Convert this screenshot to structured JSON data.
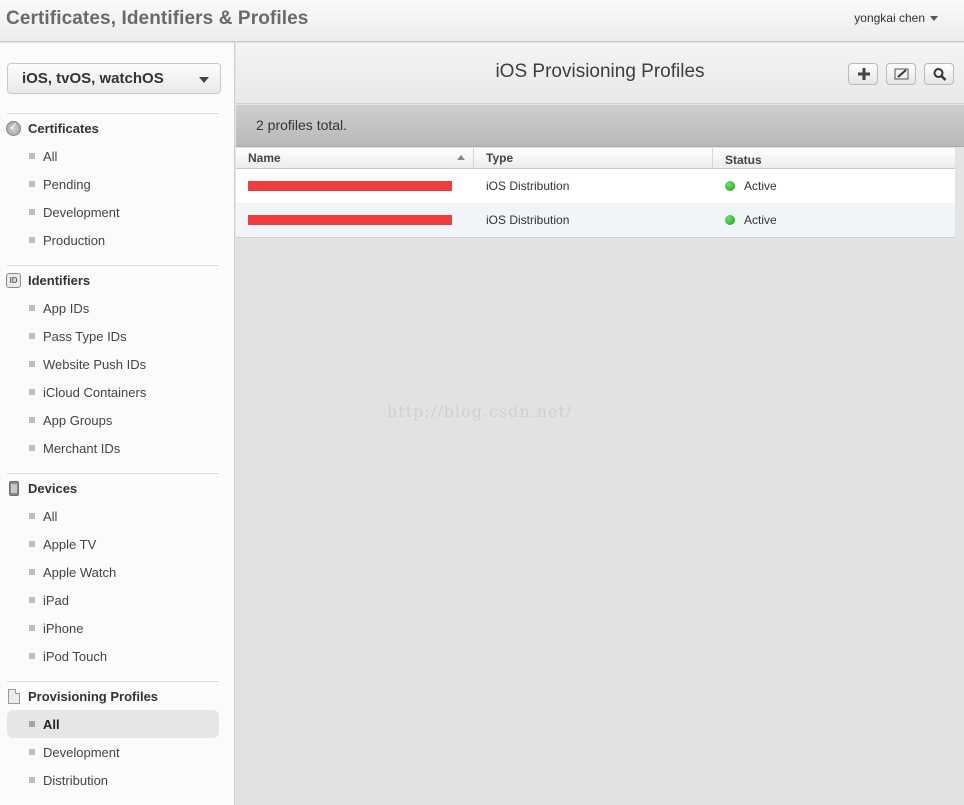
{
  "header": {
    "title": "Certificates, Identifiers & Profiles",
    "user": "yongkai chen"
  },
  "sidebar": {
    "platform": "iOS, tvOS, watchOS",
    "sections": {
      "certificates": {
        "title": "Certificates",
        "items": [
          "All",
          "Pending",
          "Development",
          "Production"
        ]
      },
      "identifiers": {
        "title": "Identifiers",
        "icon_text": "ID",
        "items": [
          "App IDs",
          "Pass Type IDs",
          "Website Push IDs",
          "iCloud Containers",
          "App Groups",
          "Merchant IDs"
        ]
      },
      "devices": {
        "title": "Devices",
        "items": [
          "All",
          "Apple TV",
          "Apple Watch",
          "iPad",
          "iPhone",
          "iPod Touch"
        ]
      },
      "profiles": {
        "title": "Provisioning Profiles",
        "items": [
          "All",
          "Development",
          "Distribution"
        ],
        "active_item": "All"
      }
    }
  },
  "main": {
    "title": "iOS Provisioning Profiles",
    "summary": "2 profiles total.",
    "columns": [
      "Name",
      "Type",
      "Status"
    ],
    "rows": [
      {
        "type": "iOS Distribution",
        "status": "Active"
      },
      {
        "type": "iOS Distribution",
        "status": "Active"
      }
    ],
    "status_color": "#2eb82e",
    "redaction_color": "#f03c3c"
  },
  "watermark": "http://blog.csdn.net/"
}
